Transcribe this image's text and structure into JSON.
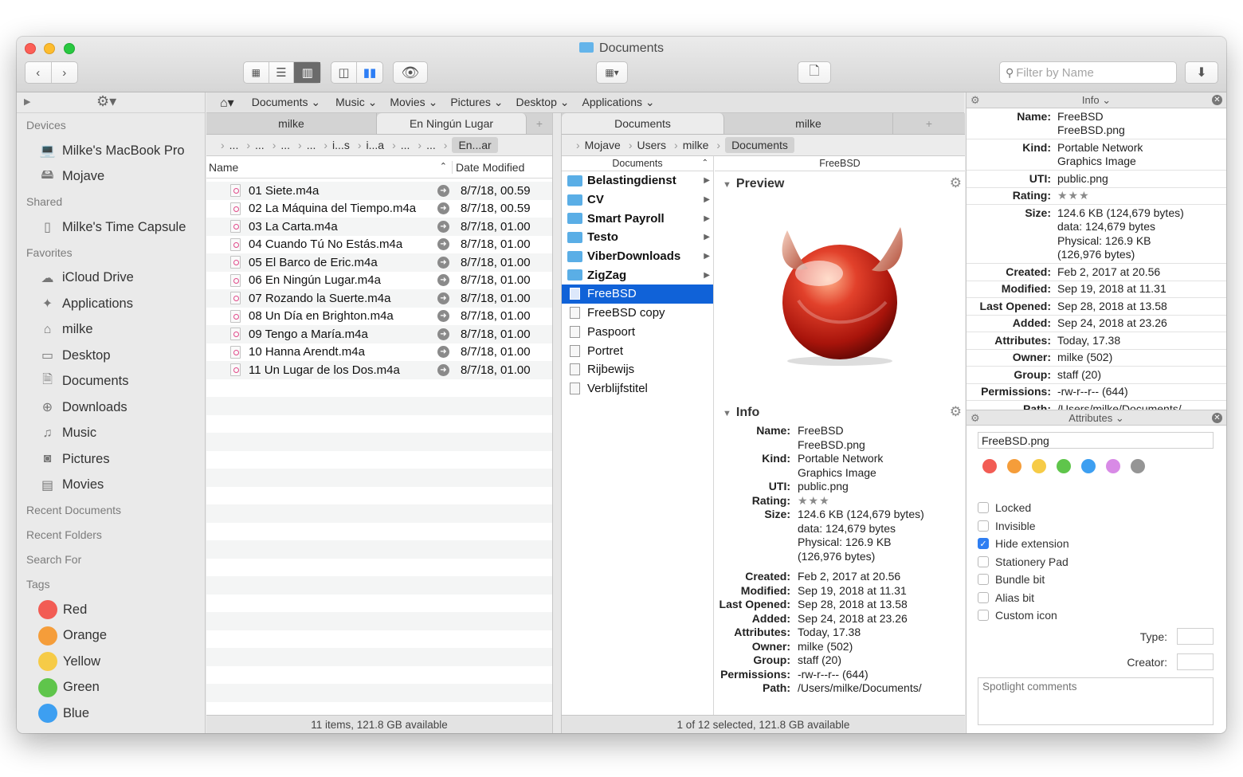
{
  "window": {
    "title": "Documents"
  },
  "toolbar": {
    "filter_placeholder": "Filter by Name"
  },
  "sidebar": {
    "sections": {
      "devices": "Devices",
      "shared": "Shared",
      "favorites": "Favorites",
      "recent_documents": "Recent Documents",
      "recent_folders": "Recent Folders",
      "search_for": "Search For",
      "tags": "Tags"
    },
    "devices": [
      "Milke's MacBook Pro",
      "Mojave"
    ],
    "shared": [
      "Milke's Time Capsule"
    ],
    "favorites": [
      "iCloud Drive",
      "Applications",
      "milke",
      "Desktop",
      "Documents",
      "Downloads",
      "Music",
      "Pictures",
      "Movies"
    ],
    "tags": [
      {
        "label": "Red",
        "color": "#f25c54"
      },
      {
        "label": "Orange",
        "color": "#f59d3a"
      },
      {
        "label": "Yellow",
        "color": "#f6cb47"
      },
      {
        "label": "Green",
        "color": "#5fc54b"
      },
      {
        "label": "Blue",
        "color": "#3d9ff1"
      }
    ]
  },
  "favbar": [
    "Documents",
    "Music",
    "Movies",
    "Pictures",
    "Desktop",
    "Applications"
  ],
  "left_pane": {
    "tabs": [
      "milke",
      "En Ningún Lugar"
    ],
    "path": [
      "...",
      "...",
      "...",
      "...",
      "i...s",
      "i...a",
      "...",
      "...",
      "En...ar"
    ],
    "col_name": "Name",
    "col_date": "Date Modified",
    "files": [
      {
        "name": "01 Siete.m4a",
        "date": "8/7/18, 00.59"
      },
      {
        "name": "02 La Máquina del Tiempo.m4a",
        "date": "8/7/18, 00.59"
      },
      {
        "name": "03 La Carta.m4a",
        "date": "8/7/18, 01.00"
      },
      {
        "name": "04 Cuando Tú No Estás.m4a",
        "date": "8/7/18, 01.00"
      },
      {
        "name": "05 El Barco de Eric.m4a",
        "date": "8/7/18, 01.00"
      },
      {
        "name": "06 En Ningún Lugar.m4a",
        "date": "8/7/18, 01.00"
      },
      {
        "name": "07 Rozando la Suerte.m4a",
        "date": "8/7/18, 01.00"
      },
      {
        "name": "08 Un Día en Brighton.m4a",
        "date": "8/7/18, 01.00"
      },
      {
        "name": "09 Tengo a María.m4a",
        "date": "8/7/18, 01.00"
      },
      {
        "name": "10 Hanna Arendt.m4a",
        "date": "8/7/18, 01.00"
      },
      {
        "name": "11 Un Lugar de los Dos.m4a",
        "date": "8/7/18, 01.00"
      }
    ],
    "status": "11 items, 121.8 GB available"
  },
  "right_pane": {
    "tabs": [
      "Documents",
      "milke"
    ],
    "path": [
      "Mojave",
      "Users",
      "milke",
      "Documents"
    ],
    "col_header": "Documents",
    "preview_col_header": "FreeBSD",
    "items": [
      {
        "name": "Belastingdienst",
        "type": "folder"
      },
      {
        "name": "CV",
        "type": "folder"
      },
      {
        "name": "Smart Payroll",
        "type": "folder"
      },
      {
        "name": "Testo",
        "type": "folder"
      },
      {
        "name": "ViberDownloads",
        "type": "folder"
      },
      {
        "name": "ZigZag",
        "type": "folder"
      },
      {
        "name": "FreeBSD",
        "type": "file"
      },
      {
        "name": "FreeBSD copy",
        "type": "file"
      },
      {
        "name": "Paspoort",
        "type": "file"
      },
      {
        "name": "Portret",
        "type": "file"
      },
      {
        "name": "Rijbewijs",
        "type": "file"
      },
      {
        "name": "Verblijfstitel",
        "type": "file"
      }
    ],
    "preview_title": "Preview",
    "info_title": "Info",
    "info": [
      {
        "k": "Name:",
        "v": "FreeBSD\nFreeBSD.png"
      },
      {
        "k": "Kind:",
        "v": "Portable Network\nGraphics Image"
      },
      {
        "k": "UTI:",
        "v": "public.png"
      },
      {
        "k": "Rating:",
        "v": "★★★"
      },
      {
        "k": "Size:",
        "v": "124.6 KB (124,679 bytes)\ndata: 124,679 bytes\nPhysical: 126.9 KB\n(126,976 bytes)"
      },
      {
        "k": "Created:",
        "v": "Feb 2, 2017 at 20.56"
      },
      {
        "k": "Modified:",
        "v": "Sep 19, 2018 at 11.31"
      },
      {
        "k": "Last Opened:",
        "v": "Sep 28, 2018 at 13.58"
      },
      {
        "k": "Added:",
        "v": "Sep 24, 2018 at 23.26"
      },
      {
        "k": "Attributes:",
        "v": "Today, 17.38"
      },
      {
        "k": "Owner:",
        "v": "milke (502)"
      },
      {
        "k": "Group:",
        "v": "staff (20)"
      },
      {
        "k": "Permissions:",
        "v": "-rw-r--r-- (644)"
      },
      {
        "k": "Path:",
        "v": "/Users/milke/Documents/"
      }
    ],
    "status": "1 of 12 selected, 121.8 GB available"
  },
  "inspector": {
    "info_header": "Info",
    "attributes_header": "Attributes",
    "filename": "FreeBSD.png",
    "colors": [
      "#f25c54",
      "#f59d3a",
      "#f6cb47",
      "#5fc54b",
      "#3d9ff1",
      "#d88ae6",
      "#959595"
    ],
    "checks": [
      {
        "label": "Locked",
        "on": false
      },
      {
        "label": "Invisible",
        "on": false
      },
      {
        "label": "Hide extension",
        "on": true
      },
      {
        "label": "Stationery Pad",
        "on": false
      },
      {
        "label": "Bundle bit",
        "on": false
      },
      {
        "label": "Alias bit",
        "on": false
      },
      {
        "label": "Custom icon",
        "on": false
      }
    ],
    "type_label": "Type:",
    "creator_label": "Creator:",
    "comments_placeholder": "Spotlight comments"
  }
}
